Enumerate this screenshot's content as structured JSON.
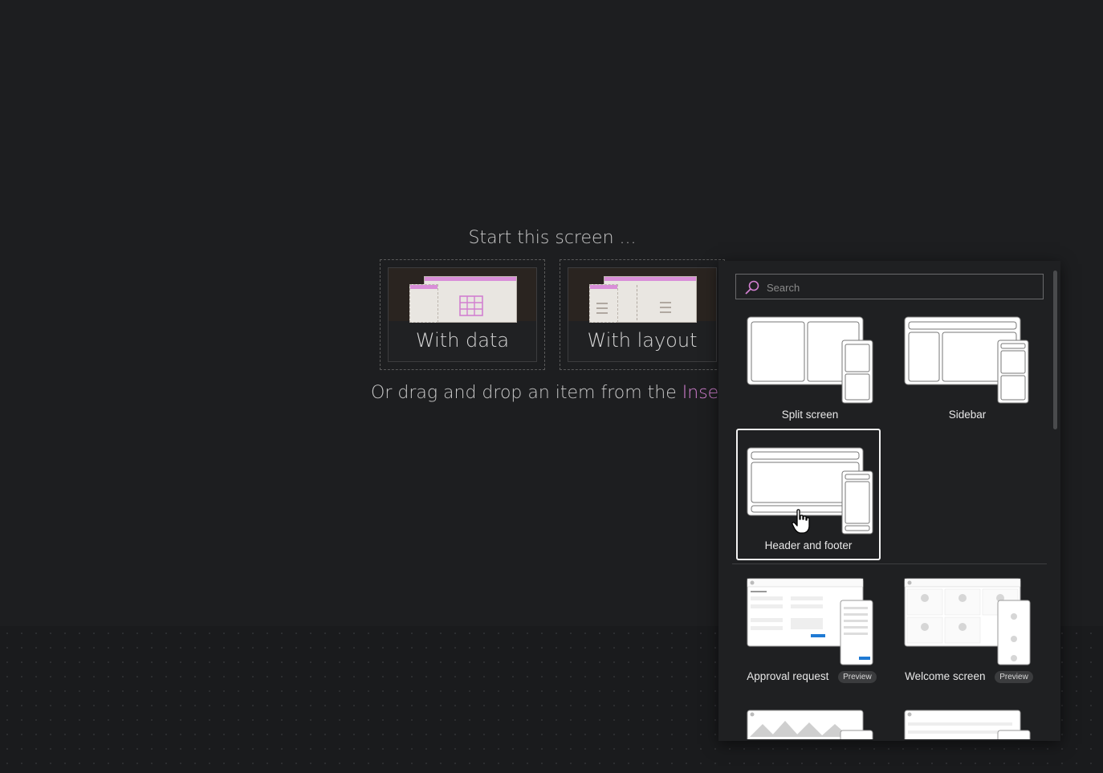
{
  "start": {
    "title": "Start this screen ...",
    "options": [
      {
        "label": "With data"
      },
      {
        "label": "With layout"
      }
    ],
    "drag_text": "Or drag and drop an item from the",
    "drag_link": "Insert pane"
  },
  "layouts_panel": {
    "search": {
      "placeholder": "Search",
      "value": ""
    },
    "layouts": [
      {
        "label": "Split screen",
        "icon": "split-screen-layout"
      },
      {
        "label": "Sidebar",
        "icon": "sidebar-layout"
      },
      {
        "label": "Header and footer",
        "icon": "header-footer-layout",
        "selected": true
      }
    ],
    "templates": [
      {
        "label": "Approval request",
        "badge": "Preview"
      },
      {
        "label": "Welcome screen",
        "badge": "Preview"
      }
    ]
  },
  "colors": {
    "accent": "#d27fd0",
    "background": "#1d1e20",
    "panel": "#1f2022"
  }
}
